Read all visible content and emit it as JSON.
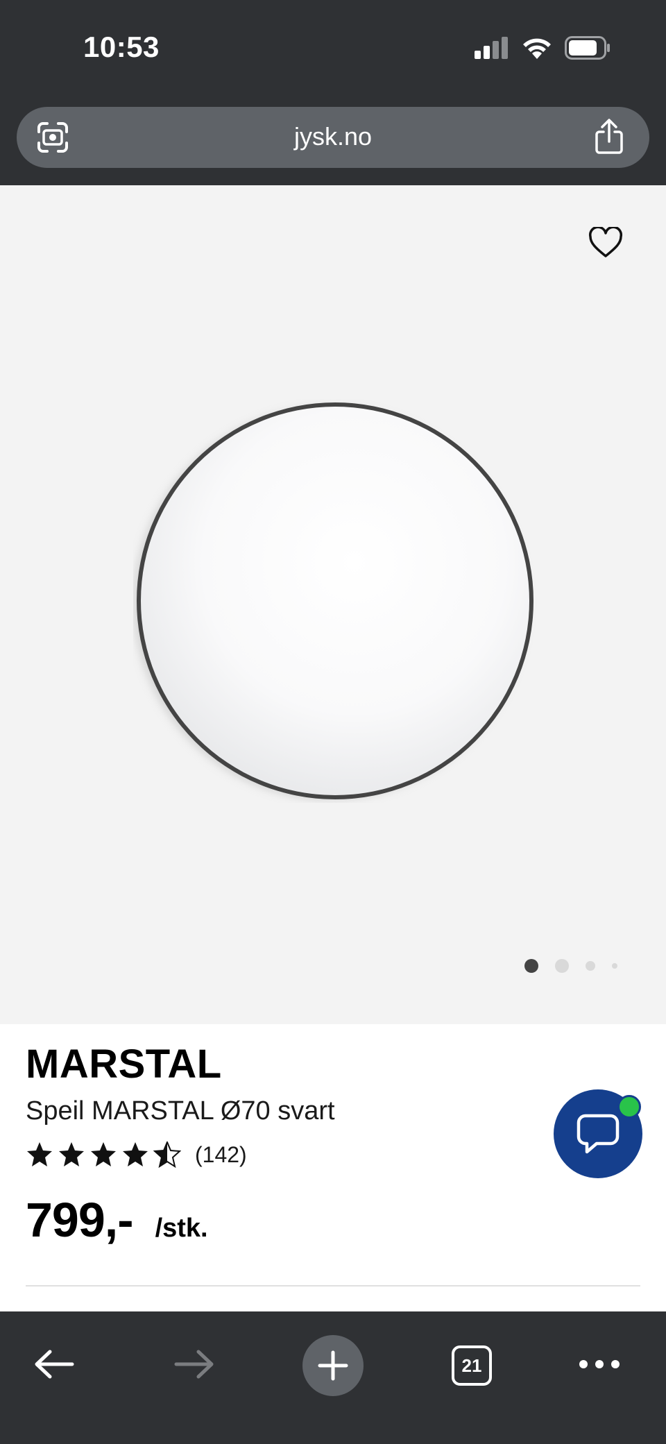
{
  "status_bar": {
    "time": "10:53",
    "icons": [
      "cellular-signal-icon",
      "wifi-icon",
      "battery-icon"
    ]
  },
  "browser": {
    "url": "jysk.no",
    "left_icon": "screen-capture-icon",
    "right_icon": "share-icon"
  },
  "gallery": {
    "favorite_icon": "heart-outline-icon",
    "image_alt": "round mirror with black frame",
    "page_count": 4,
    "active_index": 0
  },
  "product": {
    "brand": "MARSTAL",
    "name": "Speil MARSTAL Ø70 svart",
    "rating_value": 4.5,
    "rating_max": 5,
    "review_count": "(142)",
    "price": "799,-",
    "unit": "/stk."
  },
  "chat": {
    "icon": "chat-bubble-icon",
    "online_badge_color": "#29c34a",
    "button_color": "#153f8d"
  },
  "bottom_bar": {
    "back_icon": "arrow-left-icon",
    "forward_icon": "arrow-right-icon",
    "new_tab_icon": "plus-icon",
    "tab_count": "21",
    "more_icon": "more-horizontal-icon"
  }
}
